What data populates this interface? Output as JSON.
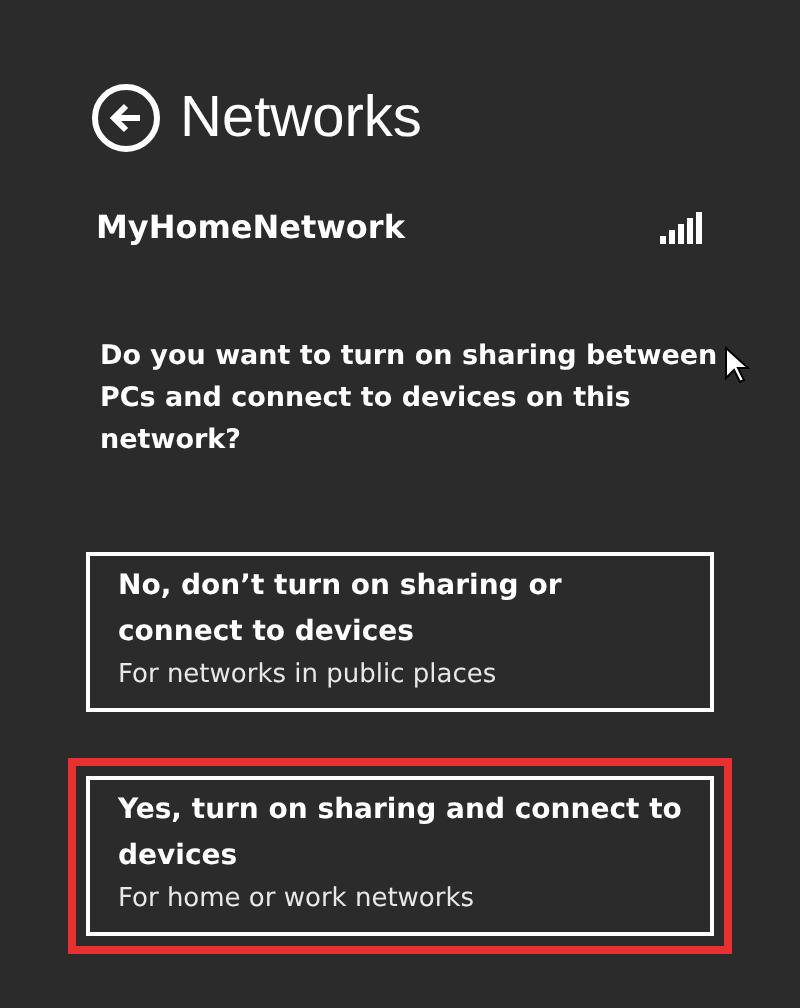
{
  "header": {
    "title": "Networks"
  },
  "network": {
    "name": "MyHomeNetwork"
  },
  "question": "Do you want to turn on sharing between PCs and connect to devices on this network?",
  "options": [
    {
      "label": "No, don’t turn on sharing or connect to devices",
      "description": "For networks in public places",
      "highlighted": false
    },
    {
      "label": "Yes, turn on sharing and connect to devices",
      "description": "For home or work networks",
      "highlighted": true
    }
  ]
}
